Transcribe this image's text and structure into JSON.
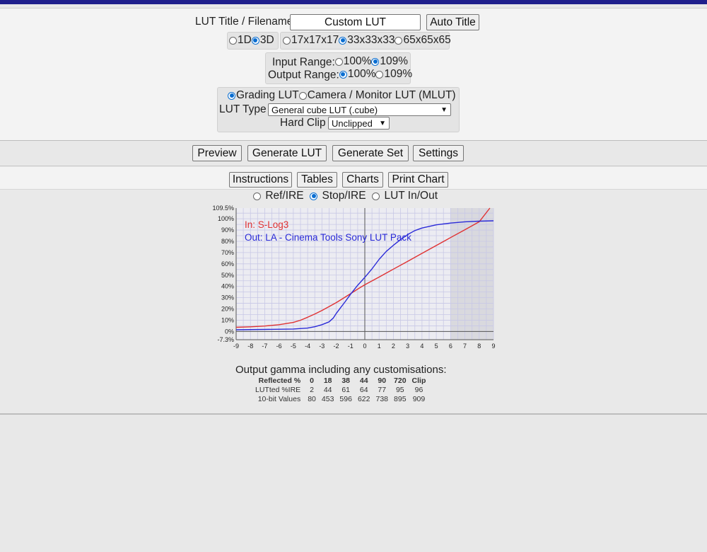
{
  "header": {
    "title_label": "LUT Title / Filename",
    "title_value": "Custom LUT",
    "auto_title_button": "Auto Title"
  },
  "dimension": {
    "options": [
      "1D",
      "3D"
    ],
    "selected": "3D"
  },
  "cube_size": {
    "options": [
      "17x17x17",
      "33x33x33",
      "65x65x65"
    ],
    "selected": "33x33x33"
  },
  "range": {
    "input_label": "Input Range:",
    "input_options": [
      "100%",
      "109%"
    ],
    "input_selected": "109%",
    "output_label": "Output Range:",
    "output_options": [
      "100%",
      "109%"
    ],
    "output_selected": "100%"
  },
  "lut_kind": {
    "options": [
      "Grading LUT",
      "Camera / Monitor LUT (MLUT)"
    ],
    "selected": "Grading LUT",
    "type_label": "LUT Type",
    "type_value": "General cube LUT (.cube)",
    "clip_label": "Hard Clip",
    "clip_value": "Unclipped"
  },
  "actions": {
    "preview": "Preview",
    "generate_lut": "Generate LUT",
    "generate_set": "Generate Set",
    "settings": "Settings"
  },
  "tabs": {
    "instructions": "Instructions",
    "tables": "Tables",
    "charts": "Charts",
    "print_chart": "Print Chart"
  },
  "chart_mode": {
    "options": [
      "Ref/IRE",
      "Stop/IRE",
      "LUT In/Out"
    ],
    "selected": "Stop/IRE"
  },
  "chart_data": {
    "type": "line",
    "legend": {
      "in_label": "In: S-Log3",
      "out_label": "Out: LA - Cinema Tools Sony LUT Pack"
    },
    "xlim": [
      -9,
      9
    ],
    "ylim": [
      -7.3,
      109.5
    ],
    "x_ticks": [
      "-9",
      "-8",
      "-7",
      "-6",
      "-5",
      "-4",
      "-3",
      "-2",
      "-1",
      "0",
      "1",
      "2",
      "3",
      "4",
      "5",
      "6",
      "7",
      "8",
      "9"
    ],
    "y_ticks": [
      {
        "v": 109.5,
        "label": "109.5%"
      },
      {
        "v": 100,
        "label": "100%"
      },
      {
        "v": 90,
        "label": "90%"
      },
      {
        "v": 80,
        "label": "80%"
      },
      {
        "v": 70,
        "label": "70%"
      },
      {
        "v": 60,
        "label": "60%"
      },
      {
        "v": 50,
        "label": "50%"
      },
      {
        "v": 40,
        "label": "40%"
      },
      {
        "v": 30,
        "label": "30%"
      },
      {
        "v": 20,
        "label": "20%"
      },
      {
        "v": 10,
        "label": "10%"
      },
      {
        "v": 0,
        "label": "0%"
      },
      {
        "v": -7.3,
        "label": "-7.3%"
      }
    ],
    "shaded_from_x": 6,
    "grid": true,
    "series": [
      {
        "name": "In: S-Log3",
        "color": "#e03232",
        "points": [
          [
            -9,
            3.7
          ],
          [
            -8,
            4.1
          ],
          [
            -7,
            4.8
          ],
          [
            -6,
            6.0
          ],
          [
            -5,
            8.0
          ],
          [
            -4.5,
            10.0
          ],
          [
            -4,
            12.6
          ],
          [
            -3.5,
            15.5
          ],
          [
            -3,
            18.6
          ],
          [
            -2.5,
            22.0
          ],
          [
            -2,
            25.6
          ],
          [
            -1.5,
            29.5
          ],
          [
            -1,
            33.5
          ],
          [
            -0.5,
            37.6
          ],
          [
            0,
            41.4
          ],
          [
            1,
            48.3
          ],
          [
            2,
            55.3
          ],
          [
            3,
            62.3
          ],
          [
            4,
            69.3
          ],
          [
            5,
            76.3
          ],
          [
            6,
            83.3
          ],
          [
            7,
            90.3
          ],
          [
            8,
            97.3
          ],
          [
            8.75,
            109.5
          ]
        ]
      },
      {
        "name": "Out: LA - Cinema Tools Sony LUT Pack",
        "color": "#2b2bd8",
        "points": [
          [
            -9,
            1.5
          ],
          [
            -7,
            1.8
          ],
          [
            -5,
            2.2
          ],
          [
            -4,
            3.0
          ],
          [
            -3.5,
            4.2
          ],
          [
            -3,
            6.0
          ],
          [
            -2.5,
            8.5
          ],
          [
            -2.2,
            12.0
          ],
          [
            -2,
            16.0
          ],
          [
            -1.7,
            21.0
          ],
          [
            -1.4,
            26.0
          ],
          [
            -1,
            33.0
          ],
          [
            -0.5,
            41.0
          ],
          [
            0,
            48.0
          ],
          [
            0.5,
            55.5
          ],
          [
            1,
            64.0
          ],
          [
            1.5,
            71.0
          ],
          [
            2,
            76.5
          ],
          [
            2.5,
            81.5
          ],
          [
            3,
            86.0
          ],
          [
            3.5,
            89.5
          ],
          [
            4,
            91.8
          ],
          [
            5,
            94.6
          ],
          [
            6,
            96.2
          ],
          [
            7,
            97.3
          ],
          [
            8,
            97.9
          ],
          [
            9,
            98.2
          ]
        ]
      }
    ]
  },
  "output_gamma": {
    "heading": "Output gamma including any customisations:",
    "rows": [
      {
        "label": "Reflected %",
        "values": [
          "0",
          "18",
          "38",
          "44",
          "90",
          "720",
          "Clip"
        ]
      },
      {
        "label": "LUTted %IRE",
        "values": [
          "2",
          "44",
          "61",
          "64",
          "77",
          "95",
          "96"
        ]
      },
      {
        "label": "10-bit Values",
        "values": [
          "80",
          "453",
          "596",
          "622",
          "738",
          "895",
          "909"
        ]
      }
    ]
  }
}
